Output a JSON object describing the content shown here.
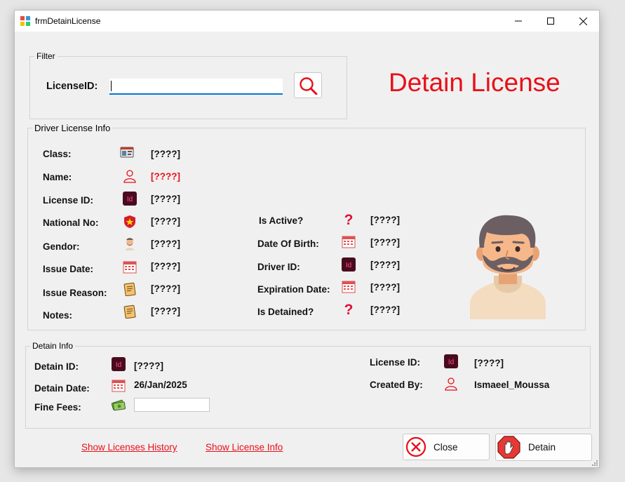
{
  "window": {
    "title": "frmDetainLicense"
  },
  "header": {
    "title": "Detain License"
  },
  "filter": {
    "group_label": "Filter",
    "license_id_label": "LicenseID:",
    "license_id_value": ""
  },
  "driver_info": {
    "group_label": "Driver License Info",
    "left": [
      {
        "label": "Class:",
        "value": "[????]",
        "icon": "license-card-icon"
      },
      {
        "label": "Name:",
        "value": "[????]",
        "icon": "user-outline-icon",
        "value_color": "#e8101a"
      },
      {
        "label": "License ID:",
        "value": "[????]",
        "icon": "id-badge-icon"
      },
      {
        "label": "National No:",
        "value": "[????]",
        "icon": "shield-star-icon"
      },
      {
        "label": "Gendor:",
        "value": "[????]",
        "icon": "person-avatar-icon"
      },
      {
        "label": "Issue Date:",
        "value": "[????]",
        "icon": "calendar-icon"
      },
      {
        "label": "Issue Reason:",
        "value": "[????]",
        "icon": "notes-icon"
      },
      {
        "label": "Notes:",
        "value": "[????]",
        "icon": "notes-icon"
      }
    ],
    "right": [
      {
        "label": "Is Active?",
        "value": "[????]",
        "icon": "question-icon"
      },
      {
        "label": "Date Of Birth:",
        "value": "[????]",
        "icon": "calendar-icon"
      },
      {
        "label": "Driver ID:",
        "value": "[????]",
        "icon": "id-badge-icon"
      },
      {
        "label": "Expiration Date:",
        "value": "[????]",
        "icon": "calendar-icon"
      },
      {
        "label": "Is Detained?",
        "value": "[????]",
        "icon": "question-icon"
      }
    ]
  },
  "detain_info": {
    "group_label": "Detain Info",
    "detain_id_label": "Detain ID:",
    "detain_id_value": "[????]",
    "detain_date_label": "Detain Date:",
    "detain_date_value": "26/Jan/2025",
    "fine_fees_label": "Fine Fees:",
    "fine_fees_value": "",
    "license_id_label": "License ID:",
    "license_id_value": "[????]",
    "created_by_label": "Created By:",
    "created_by_value": "Ismaeel_Moussa"
  },
  "footer": {
    "show_licenses_history": "Show Licenses History",
    "show_license_info": "Show License Info",
    "close_label": "Close",
    "detain_label": "Detain"
  },
  "colors": {
    "accent_red": "#e8101a",
    "window_bg": "#f0f0f0"
  }
}
